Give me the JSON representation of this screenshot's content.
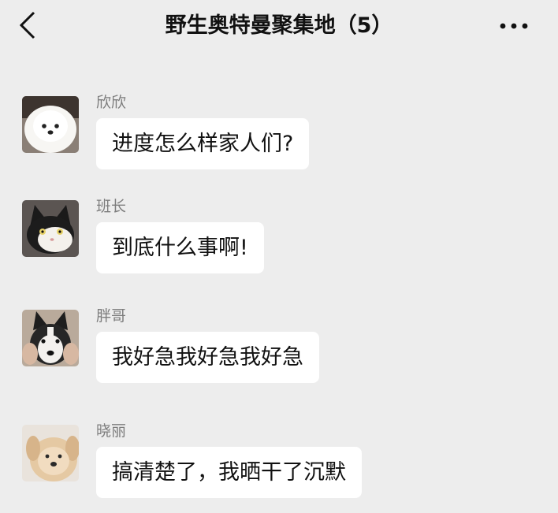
{
  "header": {
    "back_icon": "chevron-left-icon",
    "title": "野生奥特曼聚集地（5）",
    "more_icon": "more-horizontal-icon"
  },
  "messages": [
    {
      "sender": "欣欣",
      "text": "进度怎么样家人们?",
      "avatar": "white-pomeranian-avatar"
    },
    {
      "sender": "班长",
      "text": "到底什么事啊!",
      "avatar": "black-white-cat-avatar"
    },
    {
      "sender": "胖哥",
      "text": "我好急我好急我好急",
      "avatar": "husky-avatar"
    },
    {
      "sender": "晓丽",
      "text": "搞清楚了，我晒干了沉默",
      "avatar": "golden-puppy-avatar"
    }
  ],
  "colors": {
    "background": "#ededed",
    "bubble": "#ffffff",
    "sender_text": "#7d7d7d"
  }
}
